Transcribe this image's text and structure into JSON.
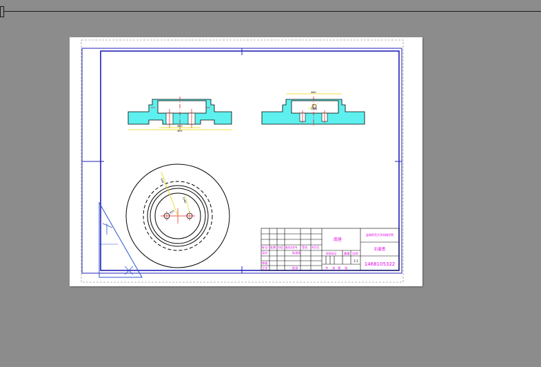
{
  "title_block": {
    "part_name": "底座",
    "school": "盐城师范大学机械学院",
    "student_name": "石曼勇",
    "student_id": "1468105322",
    "hdr_mark": "标记",
    "hdr_count": "处数",
    "hdr_zone": "分区",
    "hdr_change_no": "更改文件号",
    "hdr_sign": "签名",
    "hdr_date": "年月日",
    "lbl_design": "设计",
    "lbl_standard": "标准化",
    "lbl_review": "审核",
    "lbl_process": "工艺",
    "lbl_approve": "批准",
    "lbl_stage": "阶段标记",
    "lbl_weight": "重量",
    "lbl_scale": "比例",
    "scale_value": "1:1",
    "lbl_sheet_total": "共",
    "lbl_sheet": "张",
    "lbl_page": "第",
    "lbl_page_unit": "张"
  },
  "dims": {
    "front_width": "Φ95",
    "front_inner": "Φ60",
    "side_width": "Φ60",
    "side_hole": "2xΦ6",
    "plan_radius": "R48",
    "plan_hole": "2xΦ6",
    "plan_pcd": "Φ35"
  },
  "colors": {
    "background": "#8c8c8c",
    "paper": "#ffffff",
    "frame": "#1f1fb8",
    "section_fill": "#5ef0ee",
    "centerline": "#e11b1b",
    "dimension": "#e6d800",
    "title_text": "#e000e0",
    "outline": "#000000"
  }
}
